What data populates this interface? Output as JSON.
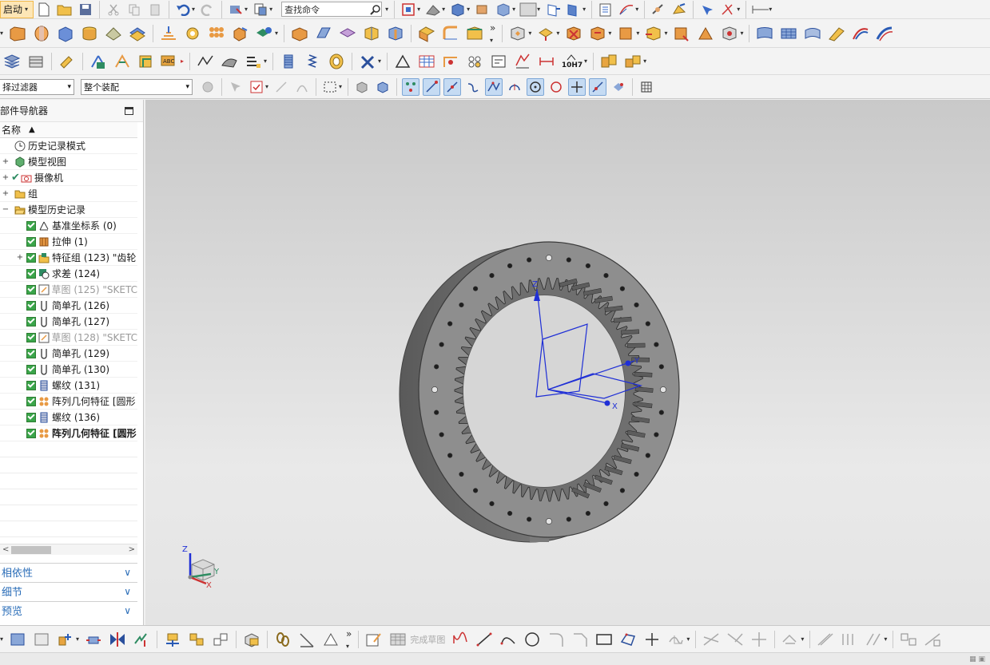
{
  "toolbar": {
    "start_label": "启动",
    "search_placeholder": "查找命令",
    "filter_dropdown": "择过滤器",
    "assembly_dropdown": "整个装配",
    "tolerance_label": "10H7",
    "sketch_done_label": "完成草图"
  },
  "navigator": {
    "title": "部件导航器",
    "column_header": "名称",
    "items": [
      {
        "label": "历史记录模式",
        "icon": "clock-icon",
        "expander": "",
        "checked": false
      },
      {
        "label": "模型视图",
        "icon": "model-views-icon",
        "expander": "+",
        "checked": false
      },
      {
        "label": "摄像机",
        "icon": "camera-icon",
        "expander": "+",
        "checked": true
      },
      {
        "label": "组",
        "icon": "folder-icon",
        "expander": "+",
        "checked": false
      },
      {
        "label": "模型历史记录",
        "icon": "folder-open-icon",
        "expander": "−",
        "checked": false
      },
      {
        "label": "基准坐标系 (0)",
        "icon": "datum-csys-icon"
      },
      {
        "label": "拉伸 (1)",
        "icon": "extrude-icon"
      },
      {
        "label": "特征组 (123) \"齿轮",
        "icon": "feature-group-icon",
        "expander": "+"
      },
      {
        "label": "求差 (124)",
        "icon": "subtract-icon"
      },
      {
        "label": "草图 (125) \"SKETC",
        "icon": "sketch-icon",
        "grey": true
      },
      {
        "label": "简单孔 (126)",
        "icon": "hole-icon"
      },
      {
        "label": "简单孔 (127)",
        "icon": "hole-icon"
      },
      {
        "label": "草图 (128) \"SKETC",
        "icon": "sketch-icon",
        "grey": true
      },
      {
        "label": "简单孔 (129)",
        "icon": "hole-icon"
      },
      {
        "label": "简单孔 (130)",
        "icon": "hole-icon"
      },
      {
        "label": "螺纹 (131)",
        "icon": "thread-icon"
      },
      {
        "label": "阵列几何特征 [圆形",
        "icon": "pattern-icon"
      },
      {
        "label": "螺纹 (136)",
        "icon": "thread-icon"
      },
      {
        "label": "阵列几何特征 [圆形",
        "icon": "pattern-icon",
        "bold": true
      }
    ],
    "panels": [
      "相依性",
      "细节",
      "预览"
    ]
  },
  "viewport": {
    "csys_labels": {
      "x": "X",
      "y": "Y",
      "z": "Z"
    },
    "triad_labels": {
      "x": "X",
      "y": "Y",
      "z": "Z"
    }
  },
  "colors": {
    "accent_blue": "#2a6db8",
    "csys_blue": "#1f2fd6",
    "check_green": "#3aa54a",
    "gear_body": "#8a8a8a"
  }
}
